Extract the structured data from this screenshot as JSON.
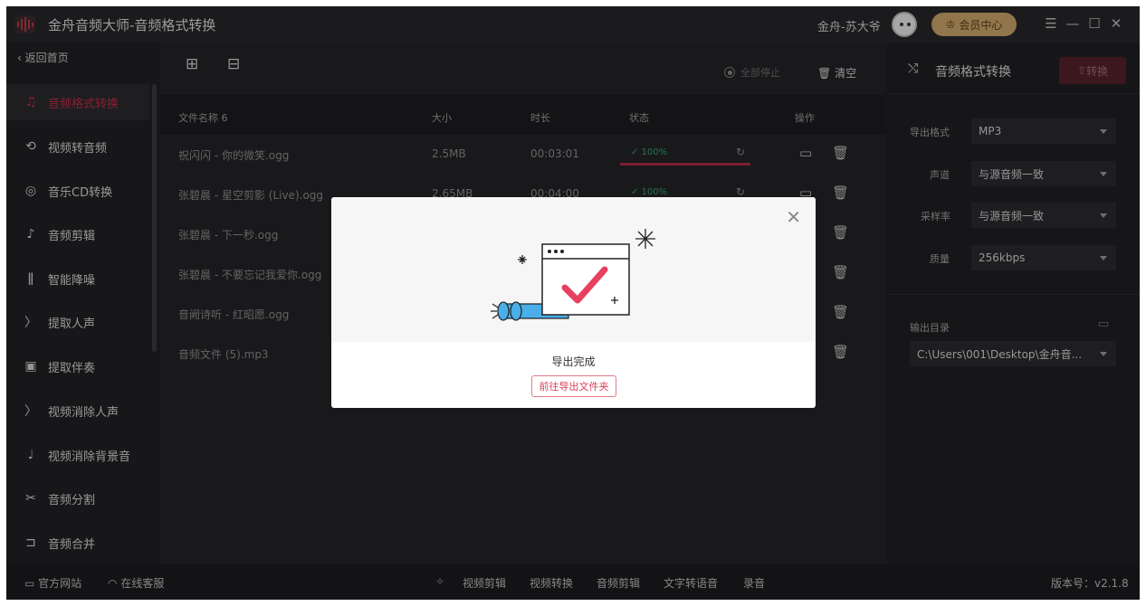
{
  "window": {
    "title": "金舟音频大师-音频格式转换",
    "user_name": "金舟-苏大爷",
    "member_label": "会员中心"
  },
  "sidebar": {
    "back_label": "返回首页",
    "items": [
      {
        "label": "音频格式转换",
        "icon": "audio-convert-icon",
        "active": true
      },
      {
        "label": "视频转音频",
        "icon": "video-to-audio-icon"
      },
      {
        "label": "音乐CD转换",
        "icon": "cd-icon"
      },
      {
        "label": "音频剪辑",
        "icon": "audio-cut-icon"
      },
      {
        "label": "智能降噪",
        "icon": "noise-reduce-icon"
      },
      {
        "label": "提取人声",
        "icon": "voice-extract-icon"
      },
      {
        "label": "提取伴奏",
        "icon": "accompaniment-icon"
      },
      {
        "label": "视频消除人声",
        "icon": "voice-remove-icon"
      },
      {
        "label": "视频消除背景音",
        "icon": "bg-remove-icon"
      },
      {
        "label": "音频分割",
        "icon": "split-icon"
      },
      {
        "label": "音频合并",
        "icon": "merge-icon"
      }
    ]
  },
  "toolbar": {
    "stop_all_label": "全部停止",
    "clear_label": "清空"
  },
  "table": {
    "headers": {
      "name": "文件名称 6",
      "size": "大小",
      "duration": "时长",
      "status": "状态",
      "action": "操作"
    },
    "rows": [
      {
        "name": "祝闪闪 - 你的微笑.ogg",
        "size": "2.5MB",
        "duration": "00:03:01",
        "status": "✓ 100%",
        "progress": 1.0
      },
      {
        "name": "张碧晨 - 星空剪影 (Live).ogg",
        "size": "2.65MB",
        "duration": "00:04:00",
        "status": "✓ 100%",
        "progress": 1.0
      },
      {
        "name": "张碧晨 - 下一秒.ogg"
      },
      {
        "name": "张碧晨 - 不要忘记我爱你.ogg"
      },
      {
        "name": "音阙诗听 - 红昭愿.ogg"
      },
      {
        "name": "音频文件 (5).mp3"
      }
    ]
  },
  "right_panel": {
    "title": "音频格式转换",
    "convert_label": "转换",
    "export_format_label": "导出格式",
    "export_format_value": "MP3",
    "channel_label": "声道",
    "channel_value": "与源音频一致",
    "sample_rate_label": "采样率",
    "sample_rate_value": "与源音频一致",
    "quality_label": "质量",
    "quality_value": "256kbps",
    "output_dir_label": "输出目录",
    "output_dir_value": "C:\\Users\\001\\Desktop\\金舟音..."
  },
  "footer": {
    "website": "官方网站",
    "support": "在线客服",
    "links": [
      "视频剪辑",
      "视频转换",
      "音频剪辑",
      "文字转语音",
      "录音"
    ],
    "version": "版本号：v2.1.8"
  },
  "modal": {
    "message": "导出完成",
    "button_label": "前往导出文件夹"
  },
  "colors": {
    "accent": "#c02c45",
    "success": "#2ea56a",
    "background": "#1f1f22"
  }
}
